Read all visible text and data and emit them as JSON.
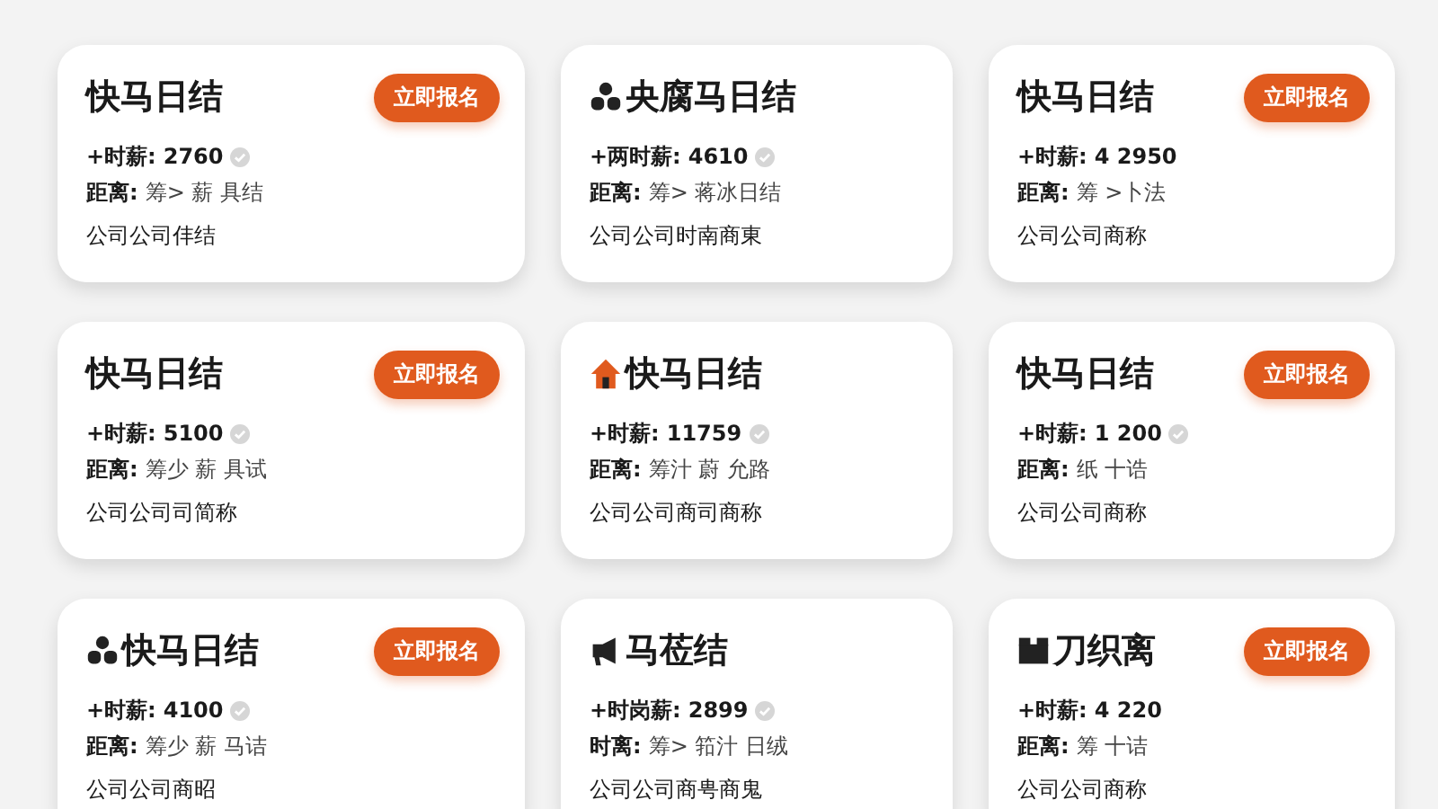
{
  "cards": [
    {
      "kind": "plain",
      "title": "快马日结",
      "button": "立即报名",
      "salary_label": "+时薪:",
      "salary": "2760",
      "verified": true,
      "distance_label": "距离:",
      "distance": "筹> 薪 具结",
      "company": "公司公司仹结"
    },
    {
      "kind": "people",
      "title": "央腐马日结",
      "salary_label": "+两时薪:",
      "salary": "4610",
      "verified": true,
      "distance_label": "距离:",
      "distance": "筹> 蒋冰日结",
      "company": "公司公司时南商東"
    },
    {
      "kind": "plain",
      "title": "快马日结",
      "button": "立即报名",
      "salary_label": "+时薪:",
      "salary": "4 2950",
      "verified": false,
      "distance_label": "距离:",
      "distance": "筹 >卜法",
      "company": "公司公司商称"
    },
    {
      "kind": "plain",
      "title": "快马日结",
      "button": "立即报名",
      "salary_label": "+时薪:",
      "salary": "5100",
      "verified": true,
      "distance_label": "距离:",
      "distance": "筹少 薪 具试",
      "company": "公司公司司简称"
    },
    {
      "kind": "house",
      "title": "快马日结",
      "salary_label": "+时薪:",
      "salary": "11759",
      "verified": true,
      "distance_label": "距离:",
      "distance": "筹汁 蔚 允路",
      "company": "公司公司商司商称"
    },
    {
      "kind": "plain",
      "title": "快马日结",
      "button": "立即报名",
      "salary_label": "+时薪:",
      "salary": "1 200",
      "verified": true,
      "distance_label": "距离:",
      "distance": "纸 十诰",
      "company": "公司公司商称"
    },
    {
      "kind": "people",
      "title": "快马日结",
      "button": "立即报名",
      "salary_label": "+时薪:",
      "salary": "4100",
      "verified": true,
      "distance_label": "距离:",
      "distance": "筹少 薪 马诘",
      "company": "公司公司商昭"
    },
    {
      "kind": "megaphone",
      "title": "马莅结",
      "salary_label": "+时岗薪:",
      "salary": "2899",
      "verified": true,
      "distance_label": "时离:",
      "distance": "筹> 筘汁 日绒",
      "company": "公司公司商甹商鬼"
    },
    {
      "kind": "box",
      "title": "刀织离",
      "button": "立即报名",
      "salary_label": "+时薪:",
      "salary": "4 220",
      "verified": false,
      "distance_label": "距离:",
      "distance": "筹 十诘",
      "company": "公司公司商称"
    }
  ]
}
